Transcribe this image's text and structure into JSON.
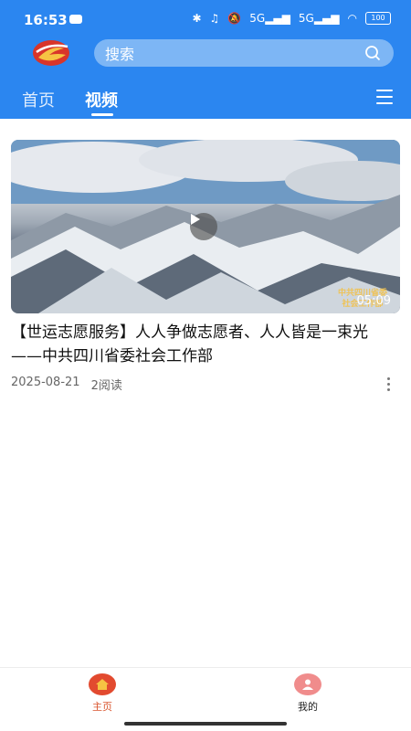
{
  "status": {
    "time": "16:53",
    "network_1": "5G",
    "network_2": "5G",
    "battery": "100"
  },
  "header": {
    "search_placeholder": "搜索"
  },
  "tabs": [
    {
      "label": "首页"
    },
    {
      "label": "视频"
    }
  ],
  "video": {
    "duration": "05:09",
    "watermark_line1": "中共四川省委",
    "watermark_line2": "社会工作部",
    "title": "【世运志愿服务】人人争做志愿者、人人皆是一束光——中共四川省委社会工作部",
    "date": "2025-08-21",
    "reads": "2阅读"
  },
  "bottom_nav": [
    {
      "label": "主页",
      "color": "#d9542d"
    },
    {
      "label": "我的",
      "color": "#222222"
    }
  ],
  "colors": {
    "brand_blue": "#2b86f0",
    "home_icon": "#e24a2f",
    "profile_icon": "#f08c8c"
  }
}
